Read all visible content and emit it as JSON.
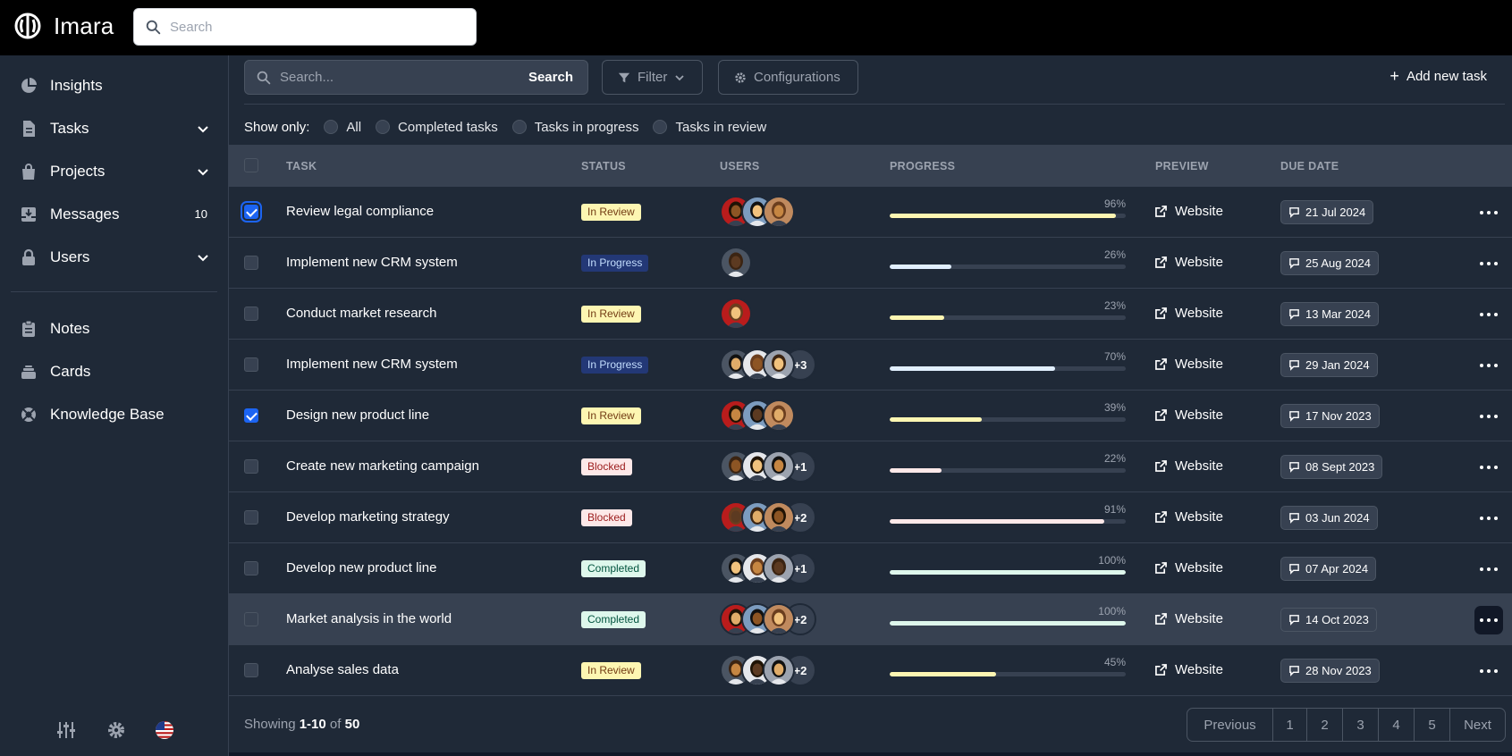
{
  "app": {
    "name": "Imara",
    "search_placeholder": "Search"
  },
  "sidebar": {
    "items": [
      {
        "label": "Insights",
        "icon": "pie-chart-icon"
      },
      {
        "label": "Tasks",
        "icon": "document-icon",
        "expandable": true
      },
      {
        "label": "Projects",
        "icon": "bag-icon",
        "expandable": true
      },
      {
        "label": "Messages",
        "icon": "inbox-icon",
        "badge": "10"
      },
      {
        "label": "Users",
        "icon": "lock-icon",
        "expandable": true
      }
    ],
    "secondary_items": [
      {
        "label": "Notes",
        "icon": "clipboard-icon"
      },
      {
        "label": "Cards",
        "icon": "stack-icon"
      },
      {
        "label": "Knowledge Base",
        "icon": "lifebuoy-icon"
      }
    ],
    "bottom_icons": [
      "sliders-icon",
      "gear-icon",
      "us-flag-icon"
    ]
  },
  "toolbar": {
    "search_placeholder": "Search...",
    "search_button": "Search",
    "filter_label": "Filter",
    "config_label": "Configurations",
    "add_label": "Add new task"
  },
  "filters": {
    "title": "Show only:",
    "options": [
      "All",
      "Completed tasks",
      "Tasks in progress",
      "Tasks in review"
    ]
  },
  "table": {
    "headers": {
      "task": "TASK",
      "status": "STATUS",
      "users": "USERS",
      "progress": "PROGRESS",
      "preview": "PREVIEW",
      "due_date": "DUE DATE"
    },
    "rows": [
      {
        "task": "Review legal compliance",
        "status": "In Review",
        "status_kind": "review",
        "avatars": 3,
        "extra": "",
        "progress": 96,
        "progress_color": "#fdf6b2",
        "preview": "Website",
        "due": "21 Jul 2024",
        "checked": true
      },
      {
        "task": "Implement new CRM system",
        "status": "In Progress",
        "status_kind": "progress",
        "avatars": 1,
        "extra": "",
        "progress": 26,
        "progress_color": "#e1effe",
        "preview": "Website",
        "due": "25 Aug 2024",
        "checked": false
      },
      {
        "task": "Conduct market research",
        "status": "In Review",
        "status_kind": "review",
        "avatars": 1,
        "extra": "",
        "progress": 23,
        "progress_color": "#fdf6b2",
        "preview": "Website",
        "due": "13 Mar 2024",
        "checked": false
      },
      {
        "task": "Implement new CRM system",
        "status": "In Progress",
        "status_kind": "progress",
        "avatars": 3,
        "extra": "+3",
        "progress": 70,
        "progress_color": "#e1effe",
        "preview": "Website",
        "due": "29 Jan 2024",
        "checked": false
      },
      {
        "task": "Design new product line",
        "status": "In Review",
        "status_kind": "review",
        "avatars": 3,
        "extra": "",
        "progress": 39,
        "progress_color": "#fdf6b2",
        "preview": "Website",
        "due": "17 Nov 2023",
        "checked": true
      },
      {
        "task": "Create new marketing campaign",
        "status": "Blocked",
        "status_kind": "blocked",
        "avatars": 3,
        "extra": "+1",
        "progress": 22,
        "progress_color": "#fde8e8",
        "preview": "Website",
        "due": "08 Sept 2023",
        "checked": false
      },
      {
        "task": "Develop marketing strategy",
        "status": "Blocked",
        "status_kind": "blocked",
        "avatars": 3,
        "extra": "+2",
        "progress": 91,
        "progress_color": "#fde8e8",
        "preview": "Website",
        "due": "03 Jun 2024",
        "checked": false
      },
      {
        "task": "Develop new product line",
        "status": "Completed",
        "status_kind": "completed",
        "avatars": 3,
        "extra": "+1",
        "progress": 100,
        "progress_color": "#def7ec",
        "preview": "Website",
        "due": "07 Apr 2024",
        "checked": false
      },
      {
        "task": "Market analysis in the world",
        "status": "Completed",
        "status_kind": "completed",
        "avatars": 3,
        "extra": "+2",
        "progress": 100,
        "progress_color": "#def7ec",
        "preview": "Website",
        "due": "14 Oct 2023",
        "checked": false
      },
      {
        "task": "Analyse sales data",
        "status": "In Review",
        "status_kind": "review",
        "avatars": 3,
        "extra": "+2",
        "progress": 45,
        "progress_color": "#fdf6b2",
        "preview": "Website",
        "due": "28 Nov 2023",
        "checked": false
      }
    ]
  },
  "footer": {
    "showing": "Showing",
    "range": "1-10",
    "of": "of",
    "total": "50",
    "pages": [
      "Previous",
      "1",
      "2",
      "3",
      "4",
      "5",
      "Next"
    ]
  },
  "colors": {
    "topbar": "#000000",
    "panel": "#1f2937",
    "header_row": "#374151",
    "accent": "#1c64f2"
  }
}
